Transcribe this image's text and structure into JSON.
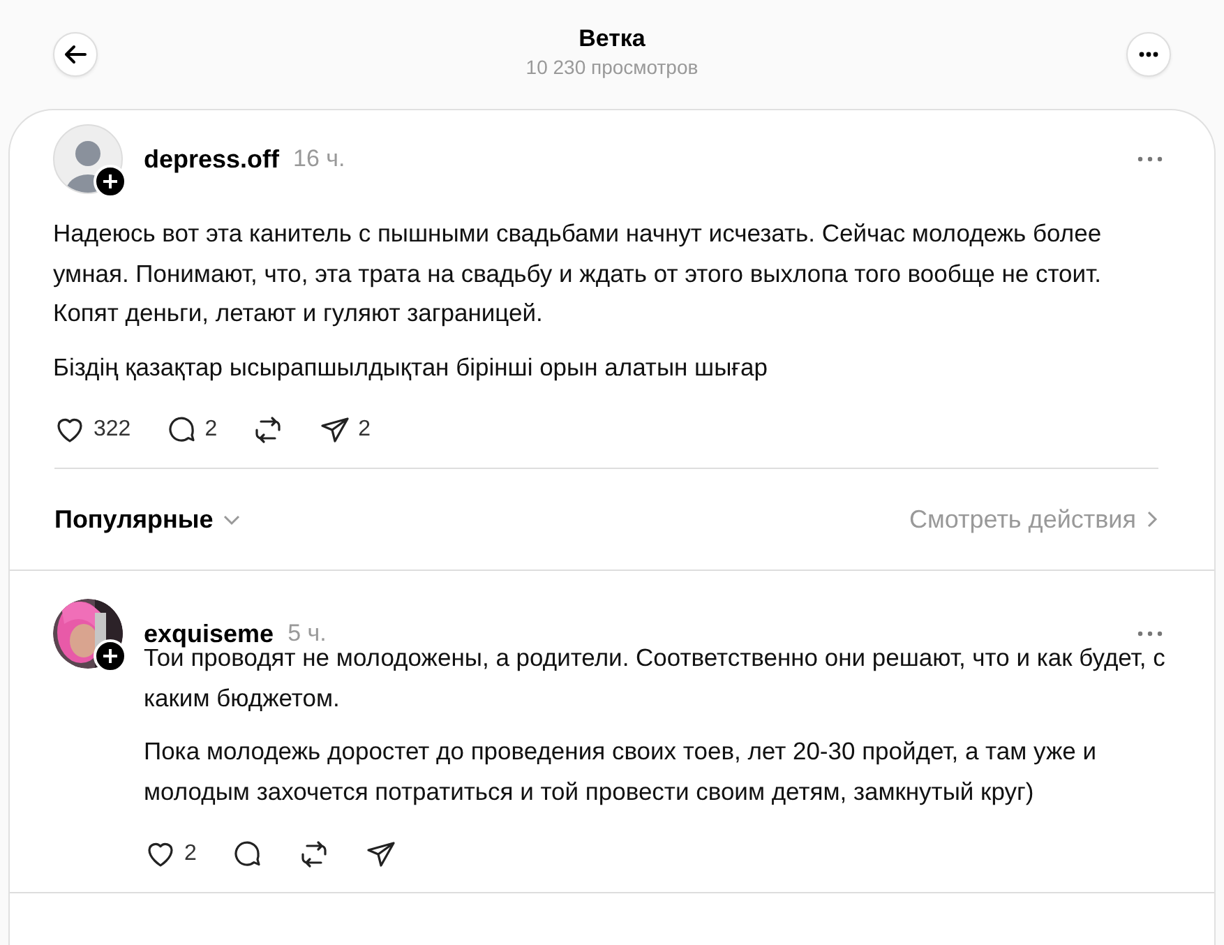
{
  "header": {
    "title": "Ветка",
    "subtitle": "10 230 просмотров"
  },
  "post": {
    "avatar": {
      "kind": "default"
    },
    "username": "depress.off",
    "time": "16 ч.",
    "paragraphs": [
      "Надеюсь вот эта канитель с пышными свадьбами начнут исчезать. Сейчас молодежь более умная. Понимают, что, эта трата на свадьбу и ждать от этого выхлопа того вообще не стоит. Копят деньги, летают и гуляют заграницей.",
      "Біздің қазақтар ысырапшылдықтан бірінші орын алатын шығар"
    ],
    "actions": [
      {
        "kind": "like",
        "count": "322"
      },
      {
        "kind": "reply",
        "count": "2"
      },
      {
        "kind": "repost"
      },
      {
        "kind": "share",
        "count": "2"
      }
    ]
  },
  "sort": {
    "label": "Популярные",
    "activity_link": "Смотреть действия"
  },
  "replies": [
    {
      "username": "exquiseme",
      "time": "5 ч.",
      "paragraphs": [
        "Тои проводят не молодожены, а родители. Соответственно они решают, что и как будет, с каким бюджетом.",
        "Пока молодежь доростет до проведения своих тоев, лет 20-30 пройдет, а там уже и молодым захочется потратиться и той провести своим детям, замкнутый круг)"
      ],
      "actions": [
        {
          "kind": "like",
          "count": "2"
        },
        {
          "kind": "reply"
        },
        {
          "kind": "repost"
        },
        {
          "kind": "share"
        }
      ]
    }
  ]
}
